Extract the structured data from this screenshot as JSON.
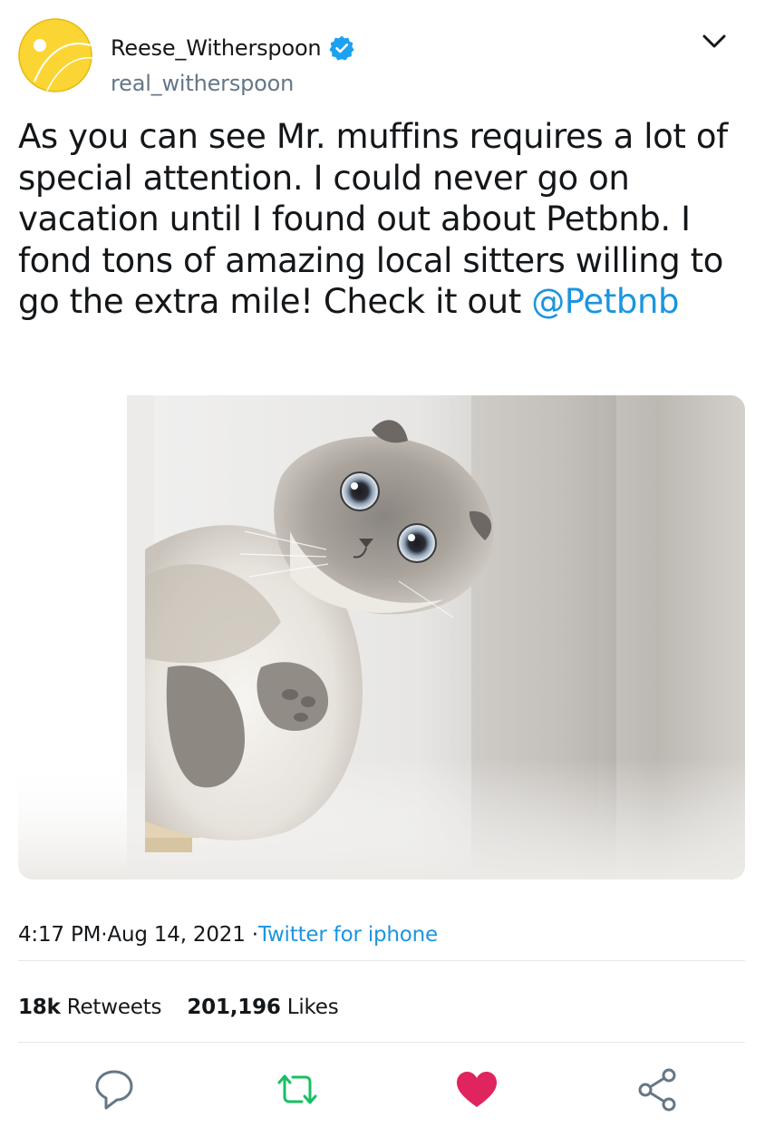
{
  "user": {
    "display_name": "Reese_Witherspoon",
    "handle": "real_witherspoon",
    "verified": true,
    "avatar_icon": "tennis-ball-icon",
    "avatar_color": "#fbd533"
  },
  "menu": {
    "icon": "chevron-down-icon"
  },
  "tweet": {
    "text": "As you can see Mr. muffins requires a lot of special attention. I could never go on vacation until I found out about Petbnb. I fond tons of amazing local sitters willing to go the extra mile! Check it out ",
    "mention": "@Petbnb",
    "media_icon": "scottish-fold-cat-photo"
  },
  "meta": {
    "time": "4:17 PM",
    "separator": "·",
    "date": " Aug 14, 2021",
    "source_separator": " ·",
    "source": "Twitter for iphone"
  },
  "stats": {
    "retweets_count": "18k",
    "retweets_label": "Retweets",
    "likes_count": "201,196",
    "likes_label": "Likes"
  },
  "actions": {
    "reply_icon": "reply-bubble-icon",
    "retweet_icon": "retweet-icon",
    "like_icon": "heart-icon",
    "share_icon": "share-icon"
  },
  "colors": {
    "link": "#1b95e0",
    "verified": "#1da1f2",
    "retweet": "#17bf63",
    "like": "#e0245e",
    "secondary_text": "#657786"
  }
}
